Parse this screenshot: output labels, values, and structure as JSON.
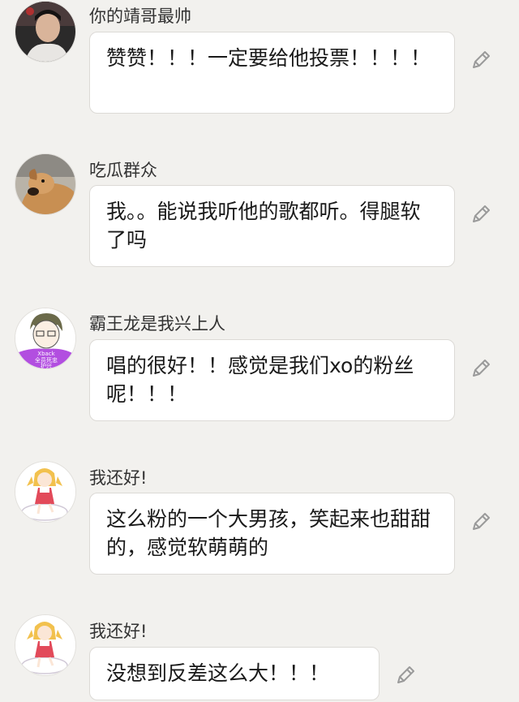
{
  "comments": [
    {
      "username": "你的靖哥最帅",
      "text": "赞赞！！！一定要给他投票！！！！",
      "avatar_icon": "person-dark-avatar-icon",
      "edit_icon": "pencil-icon"
    },
    {
      "username": "吃瓜群众",
      "text": "我。。能说我听他的歌都听。得腿软了吗",
      "avatar_icon": "dog-avatar-icon",
      "edit_icon": "pencil-icon"
    },
    {
      "username": "霸王龙是我兴上人",
      "text": "唱的很好！！感觉是我们xo的粉丝呢！！！",
      "avatar_icon": "cartoon-boy-avatar-icon",
      "avatar_text": [
        "Xback",
        "全员死忠",
        "护兴"
      ],
      "edit_icon": "pencil-icon"
    },
    {
      "username": "我还好!",
      "text": "这么粉的一个大男孩，笑起来也甜甜的，感觉软萌萌的",
      "avatar_icon": "anime-girl-avatar-icon",
      "edit_icon": "pencil-icon"
    },
    {
      "username": "我还好!",
      "text": "没想到反差这么大！！！",
      "avatar_icon": "anime-girl-avatar-icon",
      "edit_icon": "pencil-icon"
    }
  ],
  "colors": {
    "background": "#f2f1ee",
    "bubble": "#ffffff",
    "bubble_border": "#dcdad6",
    "icon": "#9a9a9a"
  }
}
